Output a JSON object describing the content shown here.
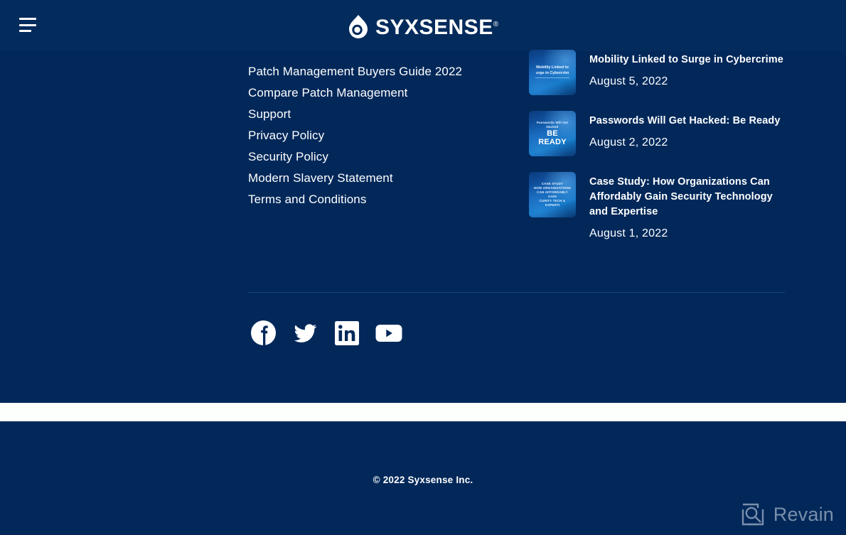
{
  "header": {
    "menu_icon": "hamburger-menu-icon",
    "logo": {
      "icon": "syxsense-droplet-logo-icon",
      "word": "SYXSENSE",
      "registered_mark": "®"
    }
  },
  "footer": {
    "links": [
      {
        "label": "Patch Management Buyers Guide 2022"
      },
      {
        "label": "Compare Patch Management"
      },
      {
        "label": "Support"
      },
      {
        "label": "Privacy Policy"
      },
      {
        "label": "Security Policy"
      },
      {
        "label": "Modern Slavery Statement"
      },
      {
        "label": "Terms and Conditions"
      }
    ],
    "posts": [
      {
        "title": "Mobility Linked to Surge in Cybercrime",
        "date": "August 5, 2022",
        "thumb_text_1": "Mobility Linked to",
        "thumb_text_2": "urge in Cybercrim"
      },
      {
        "title": "Passwords Will Get Hacked: Be Ready",
        "date": "August 2, 2022",
        "thumb_text_1": "Passwords Will Get Hacked",
        "thumb_text_2": "BE READY"
      },
      {
        "title": "Case Study: How Organizations Can Affordably Gain Security Technology and Expertise",
        "date": "August 1, 2022",
        "thumb_text_1": "CASE STUDY",
        "thumb_text_2": "HOW ORGANIZATIONS",
        "thumb_text_3": "CAN AFFORDABLY GAIN",
        "thumb_text_4": "CURITY TECH & EXPERTI"
      }
    ],
    "social": [
      {
        "name": "facebook",
        "label": "Facebook"
      },
      {
        "name": "twitter",
        "label": "Twitter"
      },
      {
        "name": "linkedin",
        "label": "LinkedIn"
      },
      {
        "name": "youtube",
        "label": "YouTube"
      }
    ],
    "copyright": "© 2022 Syxsense Inc."
  },
  "watermark": {
    "text": "Revain",
    "icon": "revain-logo-icon"
  },
  "colors": {
    "background": "#02285a",
    "header_background": "#032b5c",
    "text": "#ffffff",
    "divider": "#17447c",
    "band": "#fdfffc",
    "watermark": "#c2cddd"
  }
}
